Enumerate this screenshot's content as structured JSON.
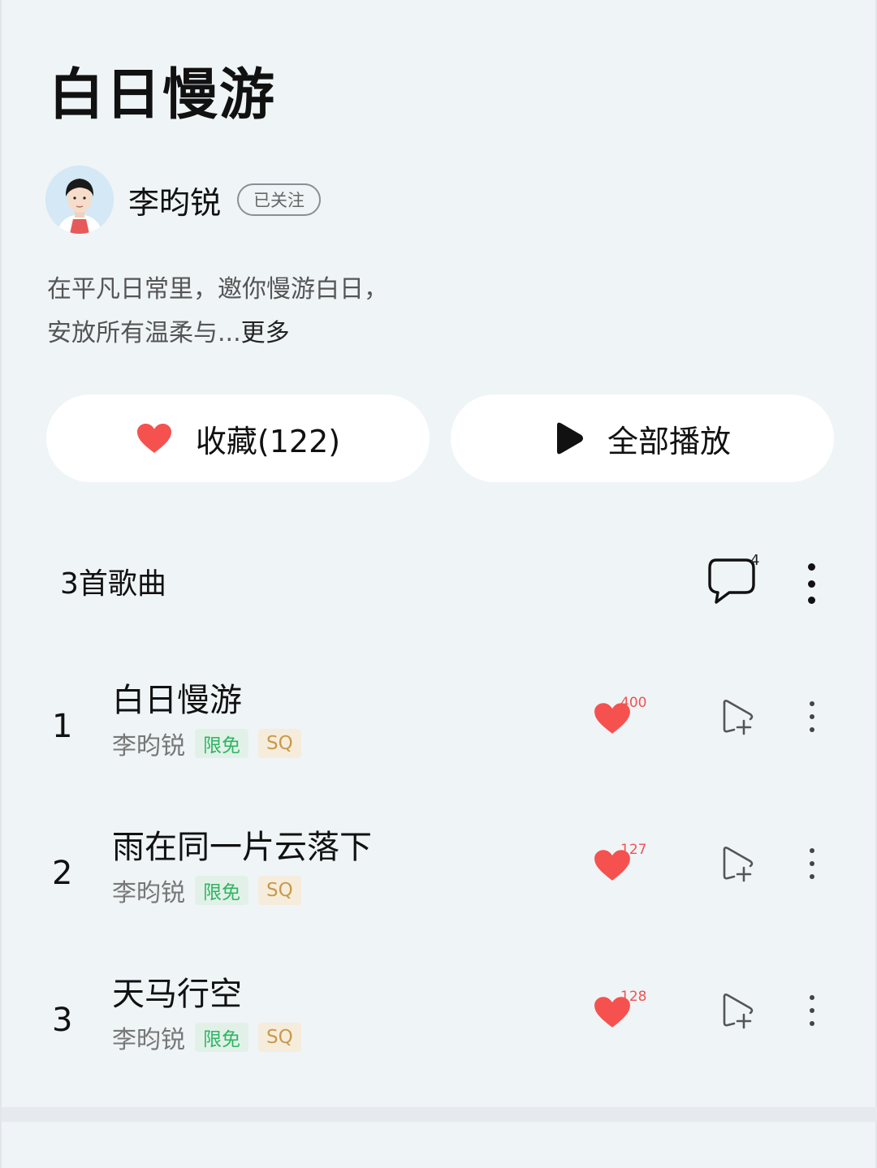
{
  "album": {
    "title": "白日慢游",
    "author": "李昀锐",
    "follow_label": "已关注",
    "description_lines": [
      "在平凡日常里，邀你慢游白日，",
      "安放所有温柔与..."
    ],
    "more_label": "更多"
  },
  "actions": {
    "favorite_label": "收藏(122)",
    "play_all_label": "全部播放"
  },
  "list_header": {
    "song_count_label": "3首歌曲",
    "comment_count": "4"
  },
  "songs": [
    {
      "index": "1",
      "name": "白日慢游",
      "artist": "李昀锐",
      "tag_free": "限免",
      "tag_quality": "SQ",
      "like_count": "400"
    },
    {
      "index": "2",
      "name": "雨在同一片云落下",
      "artist": "李昀锐",
      "tag_free": "限免",
      "tag_quality": "SQ",
      "like_count": "127"
    },
    {
      "index": "3",
      "name": "天马行空",
      "artist": "李昀锐",
      "tag_free": "限免",
      "tag_quality": "SQ",
      "like_count": "128"
    }
  ],
  "icons": {
    "heart": "heart-icon",
    "play": "play-icon",
    "comment": "comment-icon",
    "more": "more-vertical-icon",
    "add_to_playlist": "add-to-playlist-icon"
  },
  "colors": {
    "heart_red": "#f5524f",
    "free_tag_green": "#2fb463",
    "sq_tag_gold": "#c89a4a",
    "background": "#eff4f7"
  }
}
